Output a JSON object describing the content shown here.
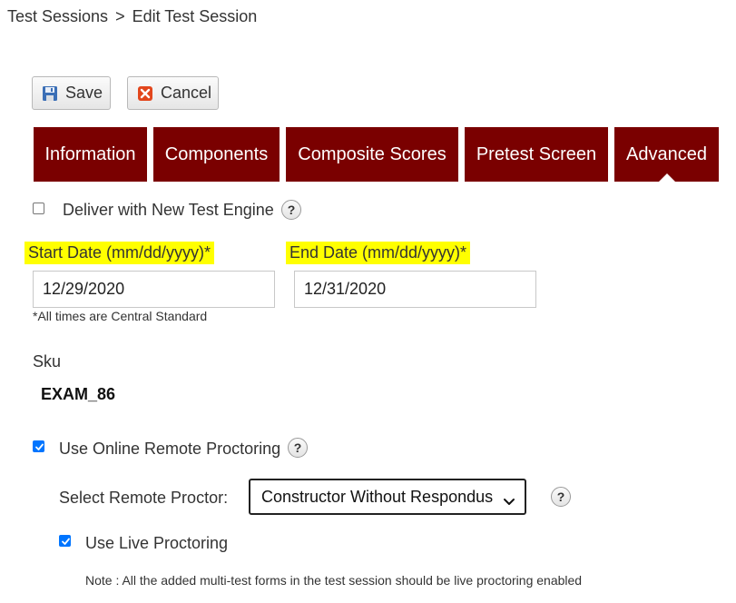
{
  "breadcrumb": {
    "parent": "Test Sessions",
    "separator": ">",
    "current": "Edit Test Session"
  },
  "toolbar": {
    "save_label": "Save",
    "cancel_label": "Cancel"
  },
  "tabs": [
    {
      "label": "Information",
      "active": false
    },
    {
      "label": "Components",
      "active": false
    },
    {
      "label": "Composite Scores",
      "active": false
    },
    {
      "label": "Pretest Screen",
      "active": false
    },
    {
      "label": "Advanced",
      "active": true
    }
  ],
  "options": {
    "new_engine_label": "Deliver with New Test Engine",
    "new_engine_checked": false
  },
  "dates": {
    "start_label": "Start Date (mm/dd/yyyy)*",
    "start_value": "12/29/2020",
    "end_label": "End Date (mm/dd/yyyy)*",
    "end_value": "12/31/2020",
    "tz_note": "*All times are Central Standard"
  },
  "sku": {
    "label": "Sku",
    "value": "EXAM_86"
  },
  "proctoring": {
    "remote_label": "Use Online Remote Proctoring",
    "remote_checked": true,
    "select_label": "Select Remote Proctor:",
    "select_value": "Constructor Without Respondus",
    "live_label": "Use Live Proctoring",
    "live_checked": true,
    "note": "Note : All the added multi-test forms in the test session should be live proctoring enabled"
  },
  "help_symbol": "?",
  "colors": {
    "tab_bg": "#7a0000",
    "highlight": "#ffff00",
    "checkbox_checked": "#0075ff"
  },
  "icons": [
    "save-disk-icon",
    "cancel-x-icon",
    "help-icon",
    "chevron-down-icon",
    "checkmark-icon"
  ]
}
